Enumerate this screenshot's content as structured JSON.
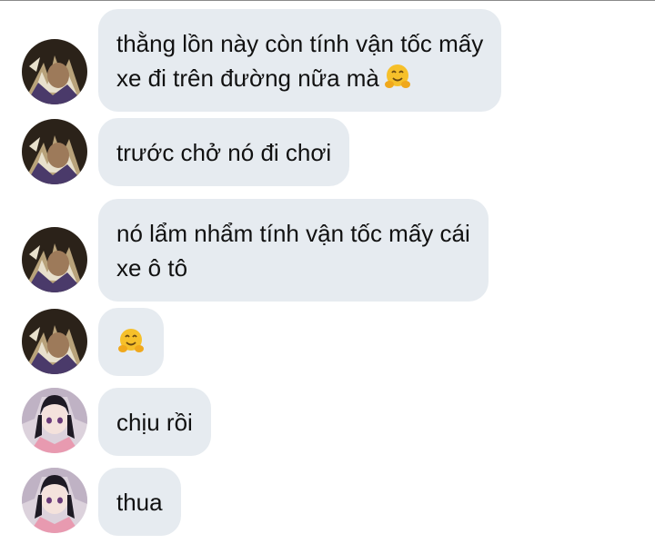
{
  "messages": [
    {
      "sender": "tanjiro-villain",
      "lines": [
        "thằng lồn này còn tính vận tốc mấy",
        "xe đi trên đường nữa mà"
      ],
      "emoji": "hugging-face-icon"
    },
    {
      "sender": "tanjiro-villain",
      "lines": [
        "trước chở nó đi chơi"
      ]
    },
    {
      "sender": "tanjiro-villain",
      "lines": [
        "nó lẩm nhẩm tính vận tốc mấy cái",
        "xe ô tô"
      ]
    },
    {
      "sender": "tanjiro-villain",
      "lines": [],
      "emoji": "hugging-face-icon"
    },
    {
      "sender": "girl-pink-kimono",
      "lines": [
        "chịu rồi"
      ]
    },
    {
      "sender": "girl-pink-kimono",
      "lines": [
        "thua"
      ]
    }
  ],
  "colors": {
    "bubble": "#e6ebf0",
    "text": "#111111",
    "emoji_face": "#f6c02a",
    "avatar_dark": "#3a2a1e",
    "avatar_light": "#d9ccd6"
  }
}
